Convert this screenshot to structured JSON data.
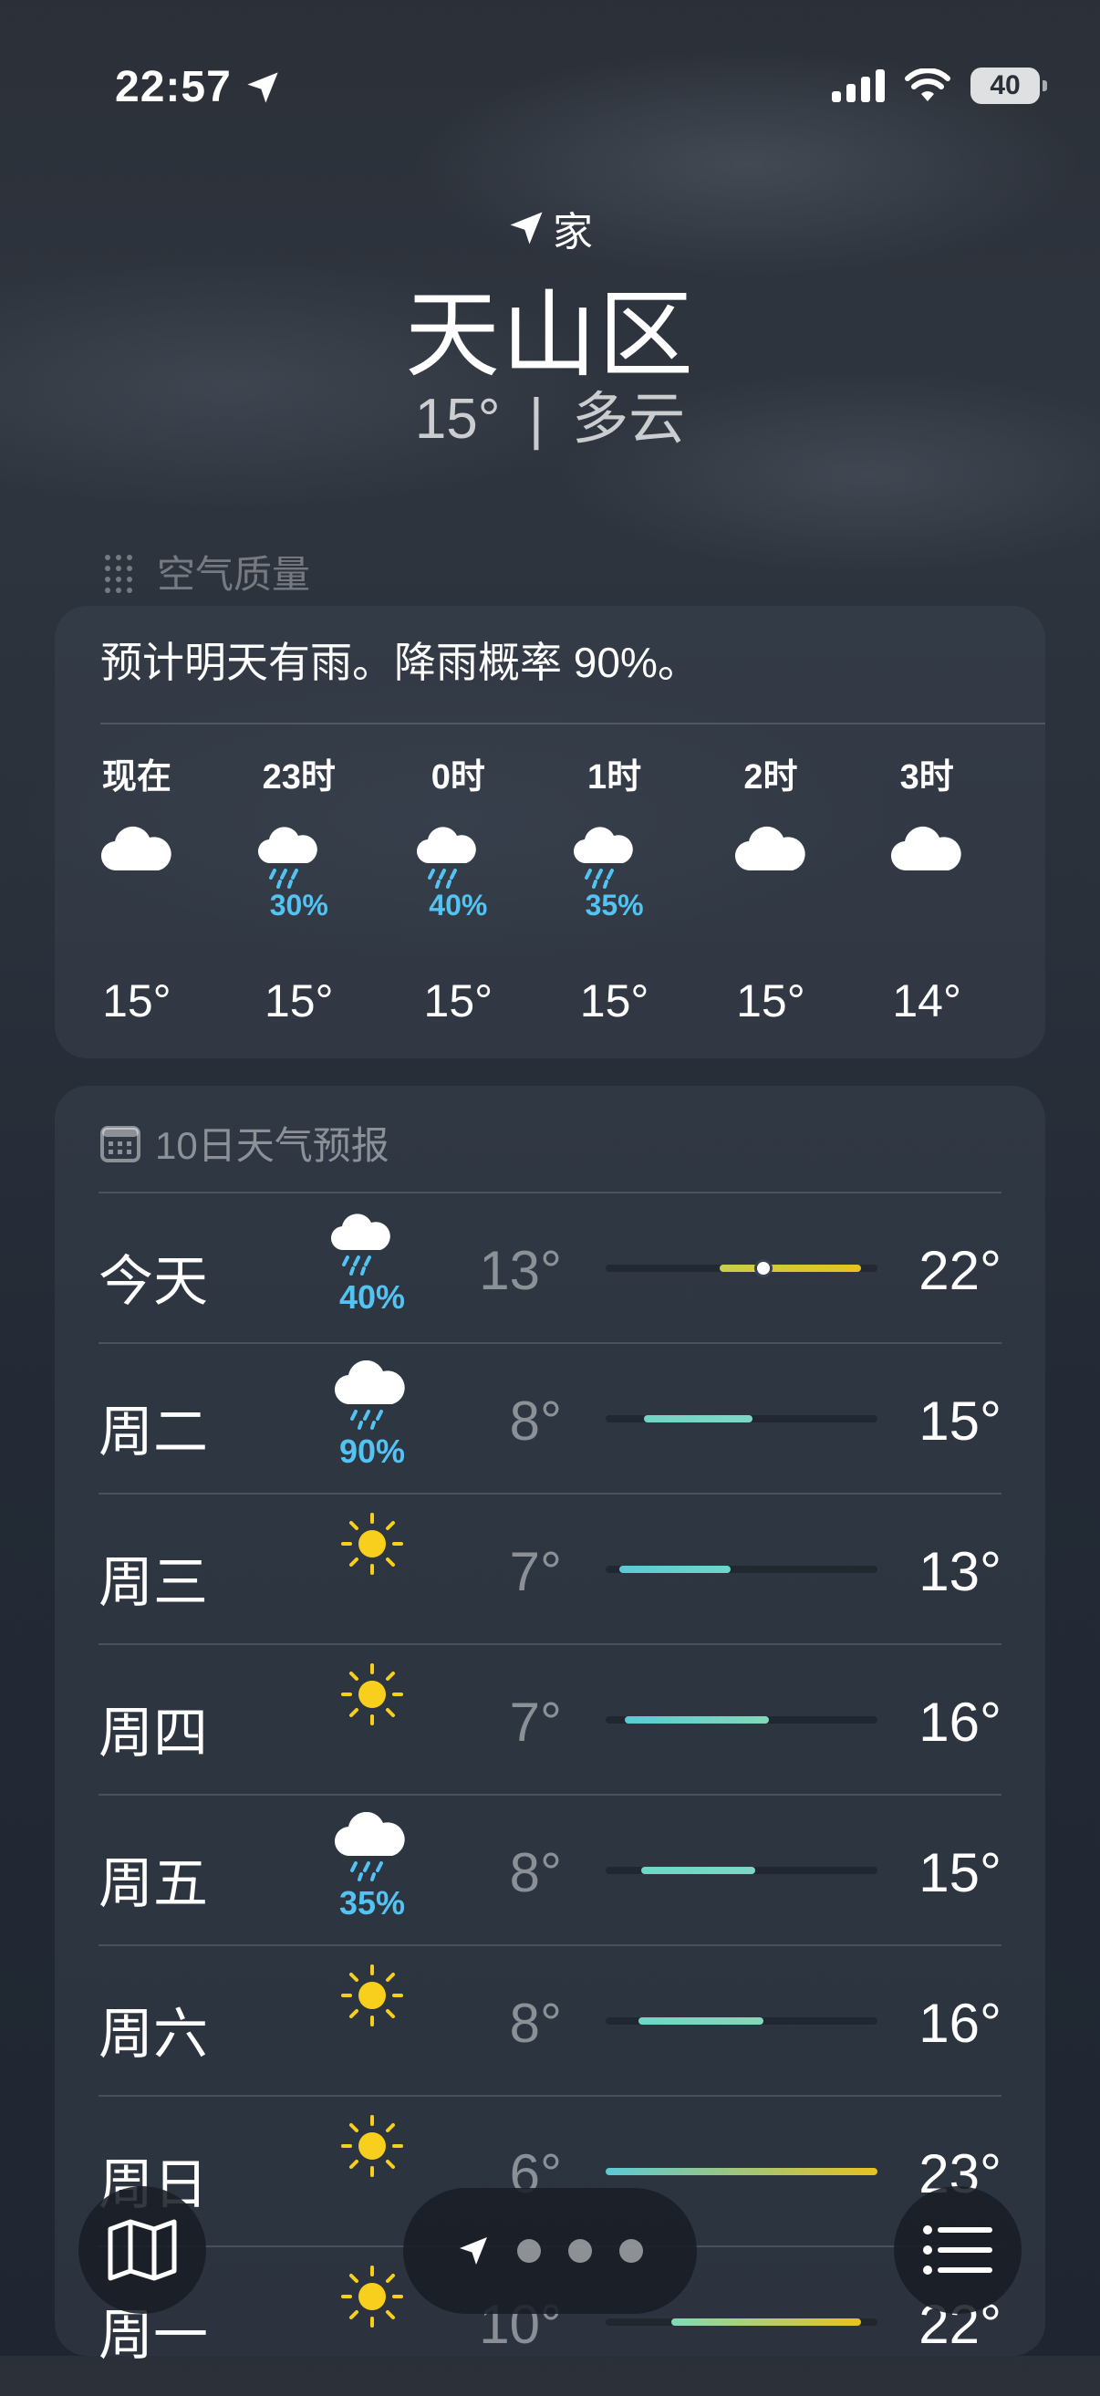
{
  "status_bar": {
    "time": "22:57",
    "battery": "40"
  },
  "header": {
    "location_tag": "家",
    "city": "天山区",
    "temperature": "15°",
    "separator": "|",
    "condition": "多云"
  },
  "air_quality": {
    "label": "空气质量"
  },
  "hourly": {
    "summary": "预计明天有雨。降雨概率 90%。",
    "items": [
      {
        "time": "现在",
        "icon": "cloud-icon",
        "precip": "",
        "temp": "15°"
      },
      {
        "time": "23时",
        "icon": "cloud-moon-rain-icon",
        "precip": "30%",
        "temp": "15°"
      },
      {
        "time": "0时",
        "icon": "cloud-moon-rain-icon",
        "precip": "40%",
        "temp": "15°"
      },
      {
        "time": "1时",
        "icon": "cloud-moon-rain-icon",
        "precip": "35%",
        "temp": "15°"
      },
      {
        "time": "2时",
        "icon": "cloud-icon",
        "precip": "",
        "temp": "15°"
      },
      {
        "time": "3时",
        "icon": "cloud-icon",
        "precip": "",
        "temp": "14°"
      }
    ]
  },
  "forecast": {
    "title": "10日天气预报",
    "days": [
      {
        "day": "今天",
        "icon": "cloud-moon-rain-icon",
        "precip": "40%",
        "low": "13°",
        "high": "22°",
        "bar_start": 0.42,
        "bar_end": 0.94,
        "bar_colors": [
          "#c7cf4a",
          "#e8c21e"
        ],
        "current_marker": 0.58
      },
      {
        "day": "周二",
        "icon": "cloud-rain-icon",
        "precip": "90%",
        "low": "8°",
        "high": "15°",
        "bar_start": 0.14,
        "bar_end": 0.54,
        "bar_colors": [
          "#6fd6c6",
          "#7fd7c4"
        ]
      },
      {
        "day": "周三",
        "icon": "sun-icon",
        "precip": "",
        "low": "7°",
        "high": "13°",
        "bar_start": 0.05,
        "bar_end": 0.46,
        "bar_colors": [
          "#5cc9d6",
          "#6fd6c6"
        ]
      },
      {
        "day": "周四",
        "icon": "sun-icon",
        "precip": "",
        "low": "7°",
        "high": "16°",
        "bar_start": 0.07,
        "bar_end": 0.6,
        "bar_colors": [
          "#5cc9d6",
          "#83d9b8"
        ]
      },
      {
        "day": "周五",
        "icon": "cloud-rain-icon",
        "precip": "35%",
        "low": "8°",
        "high": "15°",
        "bar_start": 0.13,
        "bar_end": 0.55,
        "bar_colors": [
          "#6fd6c6",
          "#7fd7c4"
        ]
      },
      {
        "day": "周六",
        "icon": "sun-icon",
        "precip": "",
        "low": "8°",
        "high": "16°",
        "bar_start": 0.12,
        "bar_end": 0.58,
        "bar_colors": [
          "#6fd6c6",
          "#83d9b8"
        ]
      },
      {
        "day": "周日",
        "icon": "sun-icon",
        "precip": "",
        "low": "6°",
        "high": "23°",
        "bar_start": 0.0,
        "bar_end": 1.0,
        "bar_colors": [
          "#5cc9d6",
          "#e8c21e"
        ]
      },
      {
        "day": "周一",
        "icon": "sun-icon",
        "precip": "",
        "low": "10°",
        "high": "22°",
        "bar_start": 0.24,
        "bar_end": 0.94,
        "bar_colors": [
          "#83d9b8",
          "#e8c21e"
        ]
      }
    ]
  },
  "colors": {
    "precip": "#52c3f2",
    "sun": "#f7cf1c"
  },
  "bottom_nav": {
    "pages": 3
  }
}
